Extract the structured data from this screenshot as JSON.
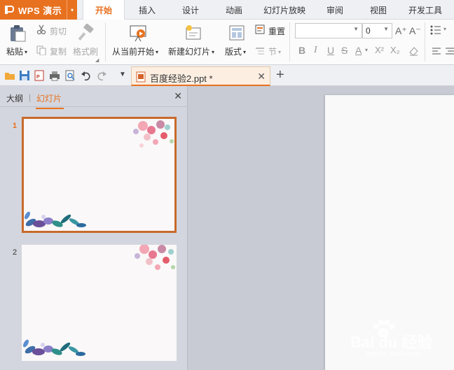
{
  "app": {
    "name": "WPS 演示"
  },
  "tabs": [
    {
      "label": "开始",
      "active": true
    },
    {
      "label": "插入",
      "active": false
    },
    {
      "label": "设计",
      "active": false
    },
    {
      "label": "动画",
      "active": false
    },
    {
      "label": "幻灯片放映",
      "active": false
    },
    {
      "label": "审阅",
      "active": false
    },
    {
      "label": "视图",
      "active": false
    },
    {
      "label": "开发工具",
      "active": false
    }
  ],
  "ribbon": {
    "paste_label": "粘贴",
    "cut_label": "剪切",
    "copy_label": "复制",
    "format_painter_label": "格式刷",
    "from_current_label": "从当前开始",
    "new_slide_label": "新建幻灯片",
    "layout_label": "版式",
    "reset_label": "重置",
    "section_label": "节",
    "font_name_value": "",
    "font_size_value": "0",
    "bold_label": "B",
    "italic_label": "I",
    "underline_label": "U",
    "strike_label": "S",
    "font_color_label": "A",
    "superscript_label": "X²",
    "subscript_label": "X₂",
    "grow_font_label": "A⁺",
    "shrink_font_label": "A⁻"
  },
  "document": {
    "tab_name": "百度经验2.ppt *"
  },
  "panel": {
    "outline_tab": "大纲",
    "slides_tab": "幻灯片",
    "slides": [
      {
        "number": "1",
        "selected": true
      },
      {
        "number": "2",
        "selected": false
      }
    ]
  },
  "watermark": {
    "brand": "Bai du 经验",
    "url": "jingyan.baidu.com"
  },
  "colors": {
    "accent": "#e8711f",
    "selection_border": "#c86a2c",
    "panel_bg": "#d3d6de",
    "canvas_bg": "#c8cbd3"
  }
}
